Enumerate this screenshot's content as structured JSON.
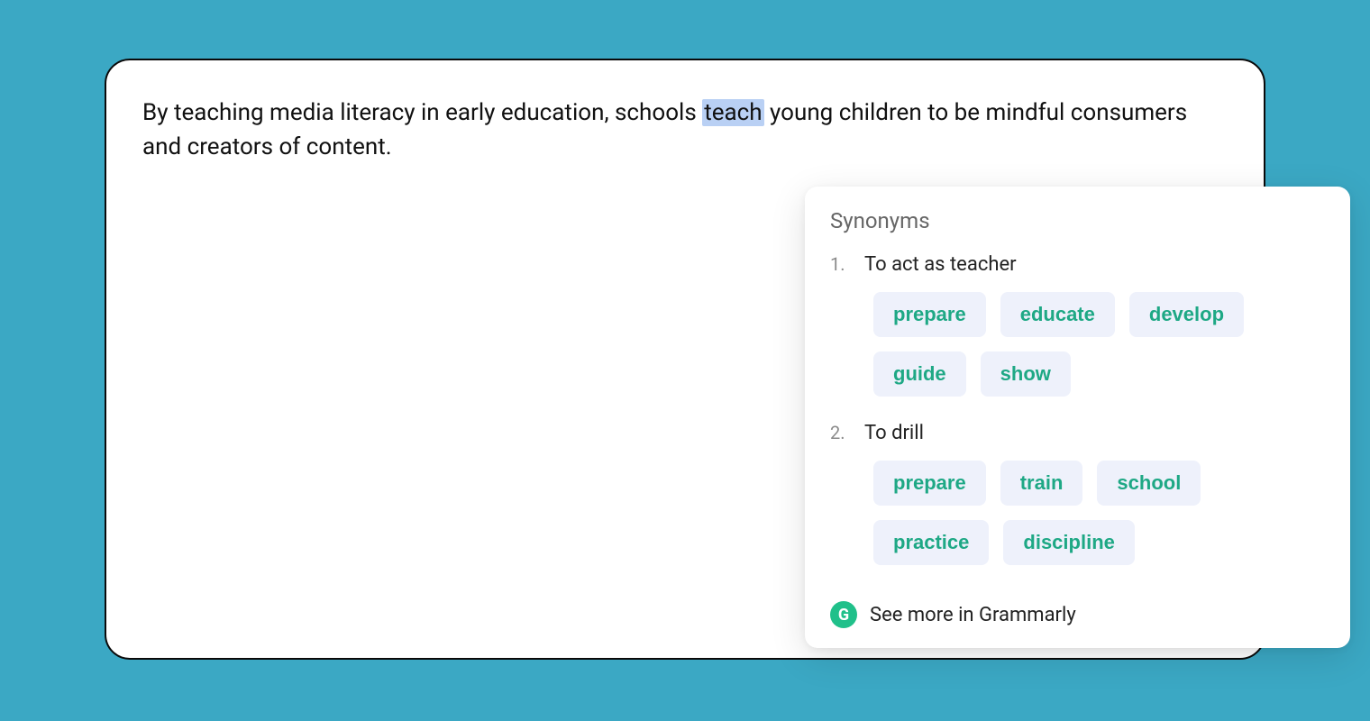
{
  "sentence": {
    "before": "By teaching media literacy in early education, schools ",
    "highlighted": "teach",
    "after": " young children to be mindful consumers and creators of content."
  },
  "popup": {
    "title": "Synonyms",
    "senses": [
      {
        "num": "1.",
        "meaning": "To act as teacher",
        "synonyms": [
          "prepare",
          "educate",
          "develop",
          "guide",
          "show"
        ]
      },
      {
        "num": "2.",
        "meaning": "To drill",
        "synonyms": [
          "prepare",
          "train",
          "school",
          "practice",
          "discipline"
        ]
      }
    ],
    "see_more": "See more in Grammarly",
    "brand_letter": "G"
  }
}
